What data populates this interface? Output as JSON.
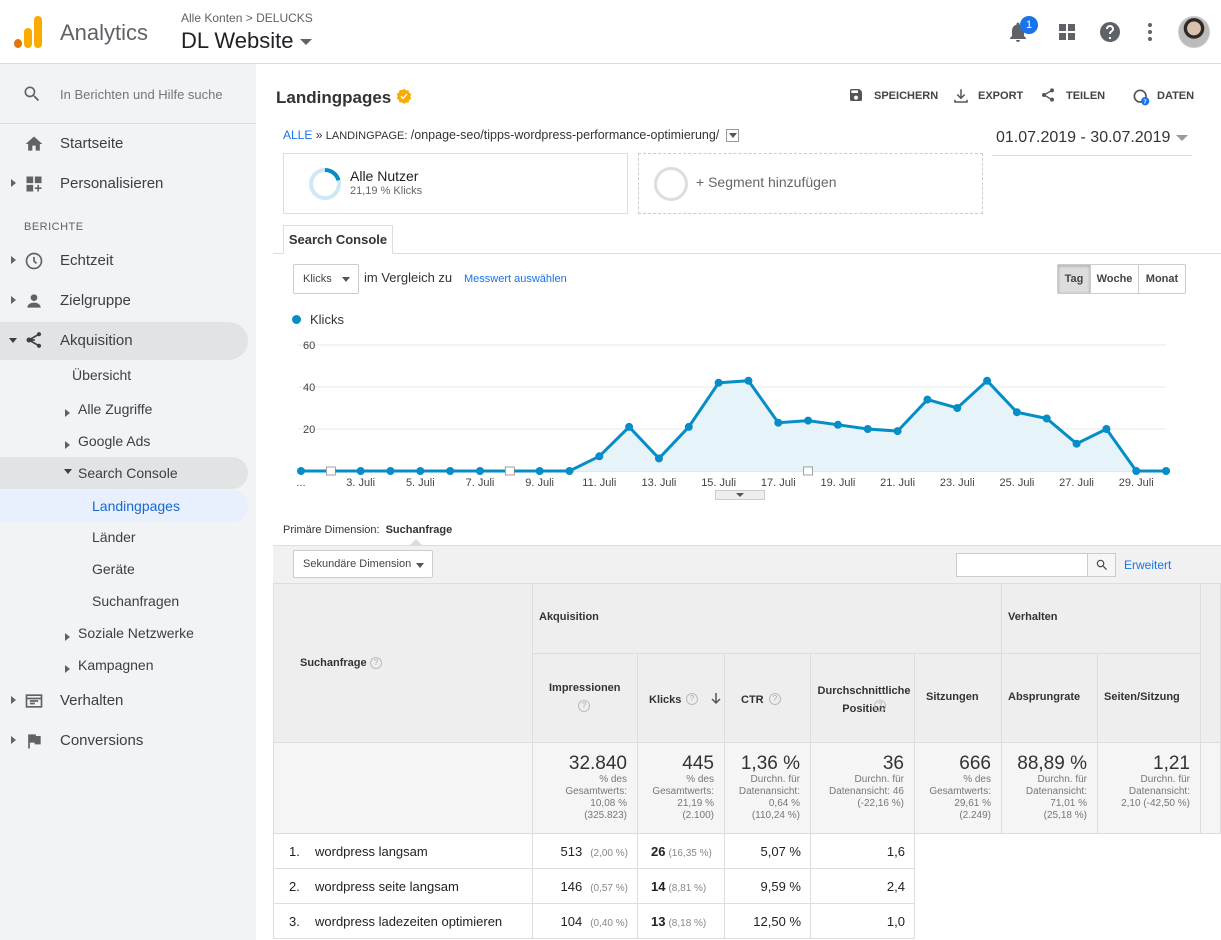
{
  "header": {
    "app_name": "Analytics",
    "breadcrumb_account": "Alle Konten",
    "breadcrumb_sep": ">",
    "breadcrumb_property": "DELUCKS",
    "property_view": "DL Website",
    "notification_count": "1"
  },
  "sidebar": {
    "search_placeholder": "In Berichten und Hilfe suche",
    "home": "Startseite",
    "customize": "Personalisieren",
    "section_label": "BERICHTE",
    "realtime": "Echtzeit",
    "audience": "Zielgruppe",
    "acquisition": "Akquisition",
    "acq_items": {
      "overview": "Übersicht",
      "all_traffic": "Alle Zugriffe",
      "google_ads": "Google Ads",
      "search_console": "Search Console",
      "landingpages": "Landingpages",
      "countries": "Länder",
      "devices": "Geräte",
      "queries": "Suchanfragen",
      "social": "Soziale Netzwerke",
      "campaigns": "Kampagnen"
    },
    "behavior": "Verhalten",
    "conversions": "Conversions"
  },
  "main": {
    "title": "Landingpages",
    "toolbar": {
      "save": "SPEICHERN",
      "export": "EXPORT",
      "share": "TEILEN",
      "data": "DATEN"
    },
    "breadcrumb": {
      "all": "ALLE",
      "sep": "»",
      "dimension": "LANDINGPAGE:",
      "value": "/onpage-seo/tipps-wordpress-performance-optimierung/"
    },
    "date_range": "01.07.2019 - 30.07.2019",
    "segment_active": {
      "name": "Alle Nutzer",
      "share": "21,19 % Klicks"
    },
    "segment_add": "+ Segment hinzufügen",
    "tab": "Search Console",
    "metric_select": "Klicks",
    "compare_label": "im Vergleich zu",
    "choose_metric": "Messwert auswählen",
    "period": {
      "day": "Tag",
      "week": "Woche",
      "month": "Monat"
    },
    "primary_dimension_label": "Primäre Dimension:",
    "primary_dimension_value": "Suchanfrage",
    "secondary_dimension": "Sekundäre Dimension",
    "advanced": "Erweitert"
  },
  "chart_data": {
    "type": "area",
    "series": [
      {
        "name": "Klicks",
        "values": [
          0,
          0,
          0,
          0,
          0,
          0,
          0,
          0,
          0,
          0,
          7,
          21,
          6,
          21,
          42,
          43,
          23,
          24,
          22,
          20,
          19,
          34,
          30,
          43,
          28,
          25,
          13,
          20,
          0,
          0
        ]
      }
    ],
    "x_tick_labels": [
      "...",
      "3. Juli",
      "5. Juli",
      "7. Juli",
      "9. Juli",
      "11. Juli",
      "13. Juli",
      "15. Juli",
      "17. Juli",
      "19. Juli",
      "21. Juli",
      "23. Juli",
      "25. Juli",
      "27. Juli",
      "29. Juli"
    ],
    "ylim": [
      0,
      60
    ],
    "y_ticks": [
      "60",
      "40",
      "20"
    ],
    "grid": true,
    "legend": "top-left",
    "color": "#058dc7"
  },
  "table": {
    "header_query": "Suchanfrage",
    "group_acquisition": "Akquisition",
    "group_behavior": "Verhalten",
    "columns": [
      "Impressionen",
      "Klicks",
      "CTR",
      "Durchschnittliche Position",
      "Sitzungen",
      "Absprungrate",
      "Seiten/Sitzung"
    ],
    "totals": [
      {
        "value": "32.840",
        "sub": [
          "% des",
          "Gesamtwerts:",
          "10,08 %",
          "(325.823)"
        ]
      },
      {
        "value": "445",
        "sub": [
          "% des",
          "Gesamtwerts:",
          "21,19 %",
          "(2.100)"
        ]
      },
      {
        "value": "1,36 %",
        "sub": [
          "Durchn. für",
          "Datenansicht:",
          "0,64 %",
          "(110,24 %)"
        ]
      },
      {
        "value": "36",
        "sub": [
          "Durchn. für",
          "Datenansicht: 46",
          "(-22,16 %)"
        ]
      },
      {
        "value": "666",
        "sub": [
          "% des",
          "Gesamtwerts:",
          "29,61 %",
          "(2.249)"
        ]
      },
      {
        "value": "88,89 %",
        "sub": [
          "Durchn. für",
          "Datenansicht:",
          "71,01 %",
          "(25,18 %)"
        ]
      },
      {
        "value": "1,21",
        "sub": [
          "Durchn. für",
          "Datenansicht:",
          "2,10 (-42,50 %)"
        ]
      }
    ],
    "rows": [
      {
        "n": "1.",
        "query": "wordpress langsam",
        "impr": "513",
        "impr_pct": "(2,00 %)",
        "clicks": "26",
        "clicks_pct": "(16,35 %)",
        "ctr": "5,07 %",
        "pos": "1,6"
      },
      {
        "n": "2.",
        "query": "wordpress seite langsam",
        "impr": "146",
        "impr_pct": "(0,57 %)",
        "clicks": "14",
        "clicks_pct": "(8,81 %)",
        "ctr": "9,59 %",
        "pos": "2,4"
      },
      {
        "n": "3.",
        "query": "wordpress ladezeiten optimieren",
        "impr": "104",
        "impr_pct": "(0,40 %)",
        "clicks": "13",
        "clicks_pct": "(8,18 %)",
        "ctr": "12,50 %",
        "pos": "1,0"
      }
    ]
  }
}
